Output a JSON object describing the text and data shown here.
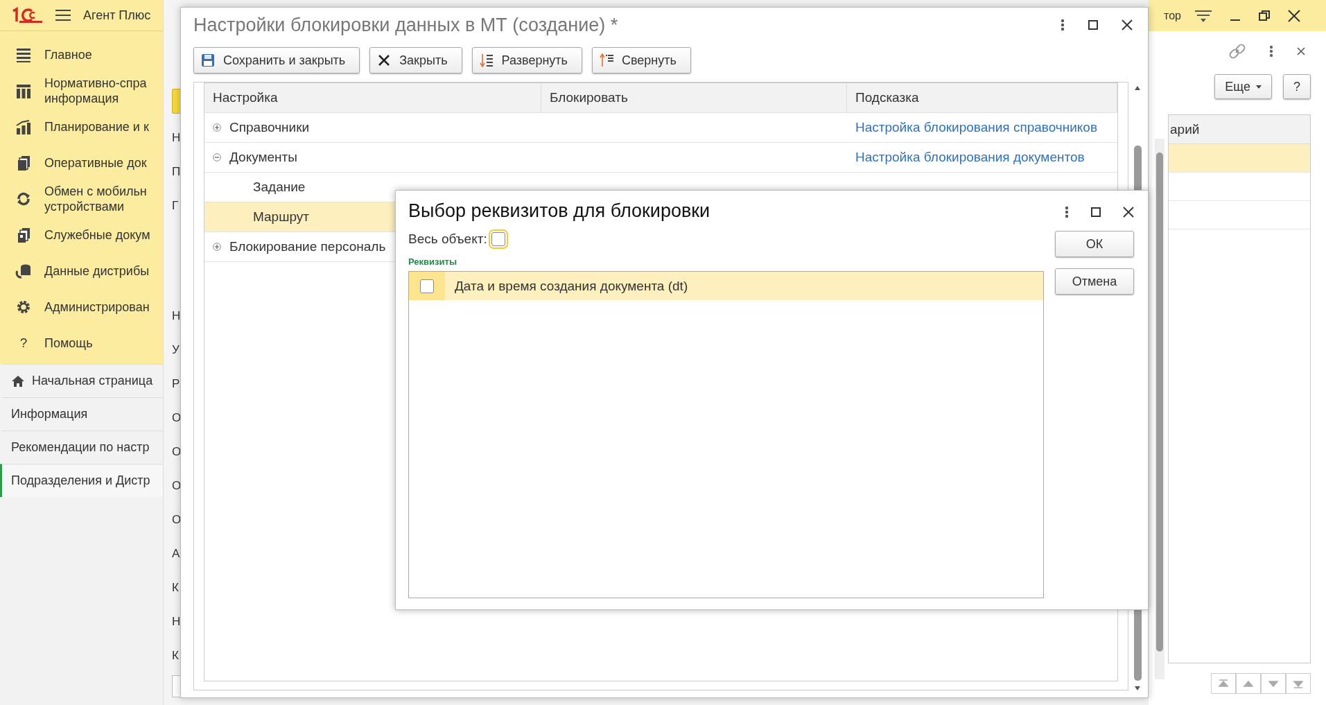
{
  "app": {
    "title": "Агент Плюс",
    "user_text": "тор"
  },
  "sidebar": {
    "sections": [
      {
        "label": "Главное"
      },
      {
        "label": "Нормативно-спра\nинформация"
      },
      {
        "label": "Планирование и к"
      },
      {
        "label": "Оперативные док"
      },
      {
        "label": "Обмен с мобильн\nустройствами"
      },
      {
        "label": "Служебные докум"
      },
      {
        "label": "Данные дистрибы"
      },
      {
        "label": "Администрирован"
      },
      {
        "label": "Помощь",
        "glyph": "?"
      }
    ],
    "pages": [
      {
        "label": "Начальная страница",
        "kind": "home",
        "selected": false
      },
      {
        "label": "Информация",
        "kind": "page",
        "selected": false
      },
      {
        "label": "Рекомендации по настр",
        "kind": "page",
        "selected": false
      },
      {
        "label": "Подразделения и Дистр",
        "kind": "page",
        "selected": true
      }
    ]
  },
  "background_form": {
    "letters": [
      "Н",
      "П",
      "Г",
      "Н",
      "У",
      "Р",
      "О",
      "О",
      "О",
      "О",
      "А",
      "К",
      "Н",
      "К"
    ]
  },
  "right_panel": {
    "buttons": [
      {
        "label": "Еще",
        "dropdown": true
      },
      {
        "label": "?",
        "dropdown": false
      }
    ],
    "column": "арий",
    "rows": [
      {
        "selected": true
      },
      {
        "selected": false
      },
      {
        "selected": false
      }
    ]
  },
  "main_window": {
    "title": "Настройки блокировки данных в МТ (создание) *",
    "toolbar": [
      {
        "label": "Сохранить и закрыть"
      },
      {
        "label": "Закрыть"
      },
      {
        "label": "Развернуть"
      },
      {
        "label": "Свернуть"
      }
    ],
    "table": {
      "columns": [
        "Настройка",
        "Блокировать",
        "Подсказка"
      ],
      "rows": [
        {
          "label": "Справочники",
          "expanded": false,
          "selected": false,
          "hint": "Настройка блокирования справочников"
        },
        {
          "label": "Документы",
          "expanded": true,
          "selected": false,
          "hint": "Настройка блокирования документов",
          "children": [
            {
              "label": "Задание",
              "selected": false
            },
            {
              "label": "Маршрут",
              "selected": true
            }
          ]
        },
        {
          "label": "Блокирование персональ",
          "expanded": false,
          "selected": false
        }
      ]
    }
  },
  "dialog": {
    "title": "Выбор реквизитов для блокировки",
    "whole_object": {
      "label": "Весь объект:",
      "checked": false
    },
    "group_label": "Реквизиты",
    "items": [
      {
        "label": "Дата и время создания документа (dt)",
        "checked": false,
        "selected": true
      }
    ],
    "buttons": [
      {
        "label": "ОК"
      },
      {
        "label": "Отмена"
      }
    ]
  }
}
